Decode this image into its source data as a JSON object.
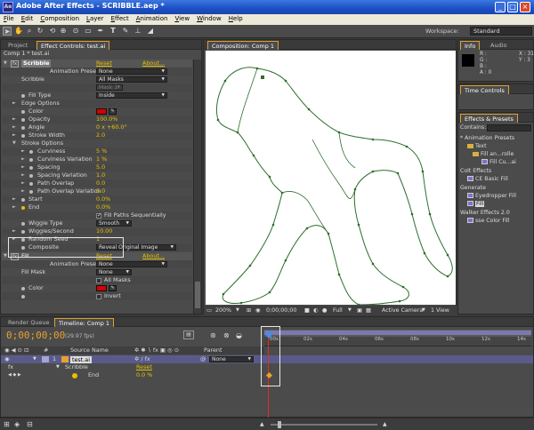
{
  "window": {
    "title": "Adobe After Effects - SCRIBBLE.aep *",
    "minimize": "_",
    "maximize": "□",
    "close": "×"
  },
  "menu": [
    "File",
    "Edit",
    "Composition",
    "Layer",
    "Effect",
    "Animation",
    "View",
    "Window",
    "Help"
  ],
  "toolbar": {
    "workspace_label": "Workspace:",
    "workspace_value": "Standard"
  },
  "left_panel": {
    "tab_project": "Project",
    "tab_effect_controls": "Effect Controls: test.ai",
    "breadcrumb": "Comp 1 * test.ai",
    "scribble": {
      "name": "Scribble",
      "reset": "Reset",
      "about": "About...",
      "animation_presets_label": "Animation Presets:",
      "animation_presets_value": "None",
      "scribble_label": "Scribble",
      "scribble_value": "All Masks",
      "mask_label": "Mask 1",
      "fill_type_label": "Fill Type",
      "fill_type_value": "Inside",
      "edge_options": "Edge Options",
      "color_label": "Color",
      "opacity_label": "Opacity",
      "opacity_value": "100.0%",
      "angle_label": "Angle",
      "angle_value": "0 x +60.0°",
      "stroke_width_label": "Stroke Width",
      "stroke_width_value": "2.0",
      "stroke_options": "Stroke Options",
      "curviness_label": "Curviness",
      "curviness_value": "5 %",
      "curviness_var_label": "Curviness Variation",
      "curviness_var_value": "1 %",
      "spacing_label": "Spacing",
      "spacing_value": "5.0",
      "spacing_var_label": "Spacing Variation",
      "spacing_var_value": "1.0",
      "path_overlap_label": "Path Overlap",
      "path_overlap_value": "0.0",
      "path_overlap_var_label": "Path Overlap Variation",
      "path_overlap_var_value": "5.0",
      "start_label": "Start",
      "start_value": "0.0%",
      "end_label": "End",
      "end_value": "0.0%",
      "fill_paths_label": "Fill Paths Sequentially",
      "wiggle_type_label": "Wiggle Type",
      "wiggle_type_value": "Smooth",
      "wiggles_label": "Wiggles/Second",
      "wiggles_value": "10.00",
      "random_seed_label": "Random Seed",
      "random_seed_value": "1",
      "composite_label": "Composite",
      "composite_value": "Reveal Original Image"
    },
    "fill": {
      "name": "Fill",
      "reset": "Reset",
      "about": "About...",
      "animation_presets_label": "Animation Presets:",
      "animation_presets_value": "None",
      "fill_mask_label": "Fill Mask",
      "fill_mask_value": "None",
      "all_masks_label": "All Masks",
      "color_label": "Color",
      "invert_label": "Invert"
    }
  },
  "composition": {
    "tab": "Composition: Comp 1",
    "zoom": "200%",
    "timecode": "0;00;00;00",
    "resolution": "Full",
    "camera": "Active Camera",
    "views": "1 View"
  },
  "right_panels": {
    "info_tab": "Info",
    "audio_tab": "Audio",
    "info_r": "R :",
    "info_g": "G :",
    "info_b": "B :",
    "info_a": "A : 0",
    "info_x": "X : 31",
    "info_y": "Y : 3",
    "time_controls_tab": "Time Controls",
    "effects_tab": "Effects & Presets",
    "contains_label": "Contains:",
    "tree": [
      "* Animation Presets",
      "Text",
      "Fill an...rolle",
      "Fill Cu...ai",
      "Colt Effects",
      "CE Basic Fill",
      "Generate",
      "Eyedropper Fill",
      "Fill",
      "Walker Effects 2.0",
      "sse Color Fill"
    ]
  },
  "timeline": {
    "tab_render": "Render Queue",
    "tab_timeline": "Timeline: Comp 1",
    "timecode": "0;00;00;00",
    "fps": "(29.97 fps)",
    "col_source": "Source Name",
    "col_parent": "Parent",
    "layer_num": "1",
    "layer_name": "test.ai",
    "parent_value": "None",
    "scribble": "Scribble",
    "reset": "Reset",
    "end_label": "End",
    "end_value": "0.0 %",
    "ruler": [
      "00s",
      "02s",
      "04s",
      "06s",
      "08s",
      "10s",
      "12s",
      "14s"
    ]
  },
  "colors": {
    "accent": "#e8a030",
    "value": "#e8c000",
    "mask_path": "#2e6e2e",
    "timeline_bar": "#5a5a8a"
  }
}
